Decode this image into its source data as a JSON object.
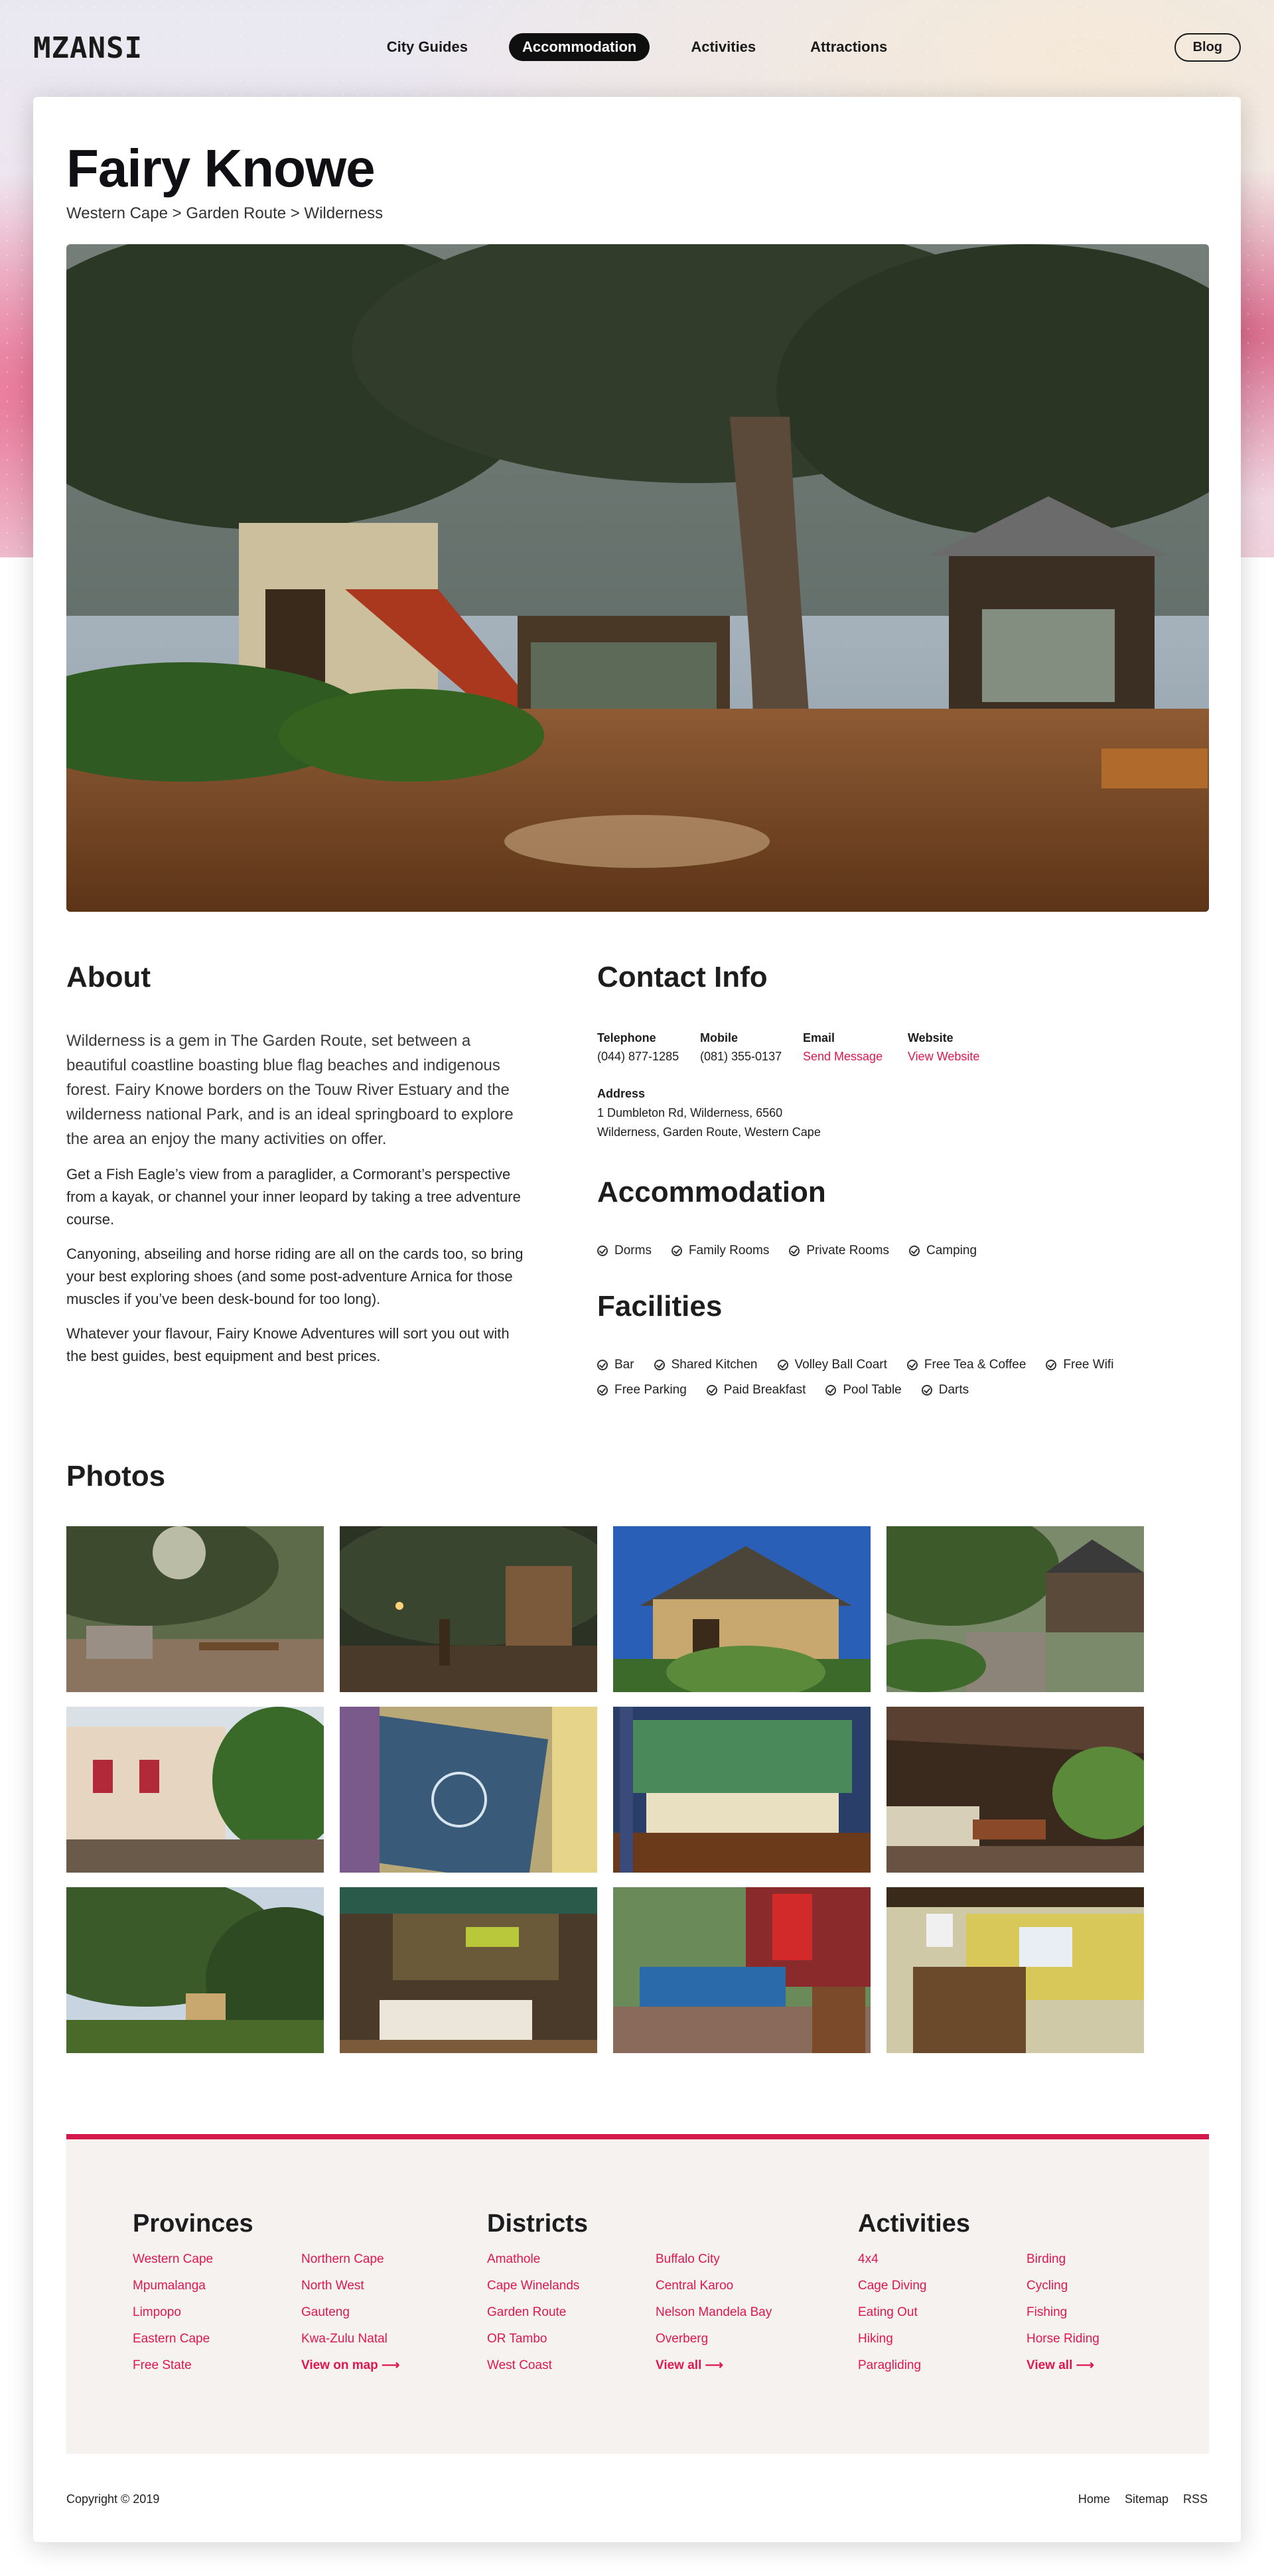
{
  "header": {
    "logo_text": "MZANSI",
    "nav": [
      "City Guides",
      "Accommodation",
      "Activities",
      "Attractions"
    ],
    "active_nav": "Accommodation",
    "blog_label": "Blog"
  },
  "listing": {
    "title": "Fairy Knowe",
    "breadcrumb": "Western Cape > Garden Route > Wilderness"
  },
  "about": {
    "heading": "About",
    "paragraphs": [
      "Wilderness is a gem in The Garden Route, set between a beautiful coastline boasting blue flag beaches and indigenous forest. Fairy Knowe borders on the Touw River Estuary and the wilderness national Park, and is an ideal springboard to explore the area an enjoy the many activities on offer.",
      "Get a Fish Eagle’s view from a paraglider, a Cormorant’s perspective from a kayak, or channel your inner leopard by taking a tree adventure course.",
      "Canyoning, abseiling and horse riding are all on the cards too, so bring your best exploring shoes (and some post-adventure Arnica for those muscles if you’ve been desk-bound for too long).",
      "Whatever your flavour, Fairy Knowe Adventures will sort you out with the best guides, best equipment and best prices."
    ]
  },
  "contact": {
    "heading": "Contact Info",
    "telephone_label": "Telephone",
    "telephone": "(044) 877-1285",
    "mobile_label": "Mobile",
    "mobile": "(081) 355-0137",
    "email_label": "Email",
    "email": "Send Message",
    "website_label": "Website",
    "website": "View Website",
    "address_label": "Address",
    "address_line1": "1 Dumbleton Rd, Wilderness, 6560",
    "address_line2": "Wilderness, Garden Route, Western Cape"
  },
  "accommodation": {
    "heading": "Accommodation",
    "items": [
      "Dorms",
      "Family Rooms",
      "Private Rooms",
      "Camping"
    ]
  },
  "facilities": {
    "heading": "Facilities",
    "items": [
      "Bar",
      "Shared Kitchen",
      "Volley Ball Coart",
      "Free Tea & Coffee",
      "Free Wifi",
      "Free Parking",
      "Paid Breakfast",
      "Pool Table",
      "Darts"
    ]
  },
  "photos": {
    "heading": "Photos",
    "count": 12
  },
  "footer": {
    "provinces": {
      "heading": "Provinces",
      "links": [
        "Western Cape",
        "Northern Cape",
        "Mpumalanga",
        "North West",
        "Limpopo",
        "Gauteng",
        "Eastern Cape",
        "Kwa-Zulu Natal",
        "Free State",
        "View on map ⟶"
      ]
    },
    "districts": {
      "heading": "Districts",
      "links": [
        "Amathole",
        "Buffalo City",
        "Cape Winelands",
        "Central Karoo",
        "Garden Route",
        "Nelson Mandela Bay",
        "OR Tambo",
        "Overberg",
        "West Coast",
        "View all ⟶"
      ]
    },
    "activities": {
      "heading": "Activities",
      "links": [
        "4x4",
        "Birding",
        "Cage Diving",
        "Cycling",
        "Eating Out",
        "Fishing",
        "Hiking",
        "Horse Riding",
        "Paragliding",
        "View all ⟶"
      ]
    },
    "copyright": "Copyright © 2019",
    "bottom_links": [
      "Home",
      "Sitemap",
      "RSS"
    ]
  },
  "colors": {
    "accent": "#e0174f",
    "footer_bar": "#d3194b",
    "footer_bg": "#f6f2ef",
    "nav_active_bg": "#0f0f0f"
  }
}
